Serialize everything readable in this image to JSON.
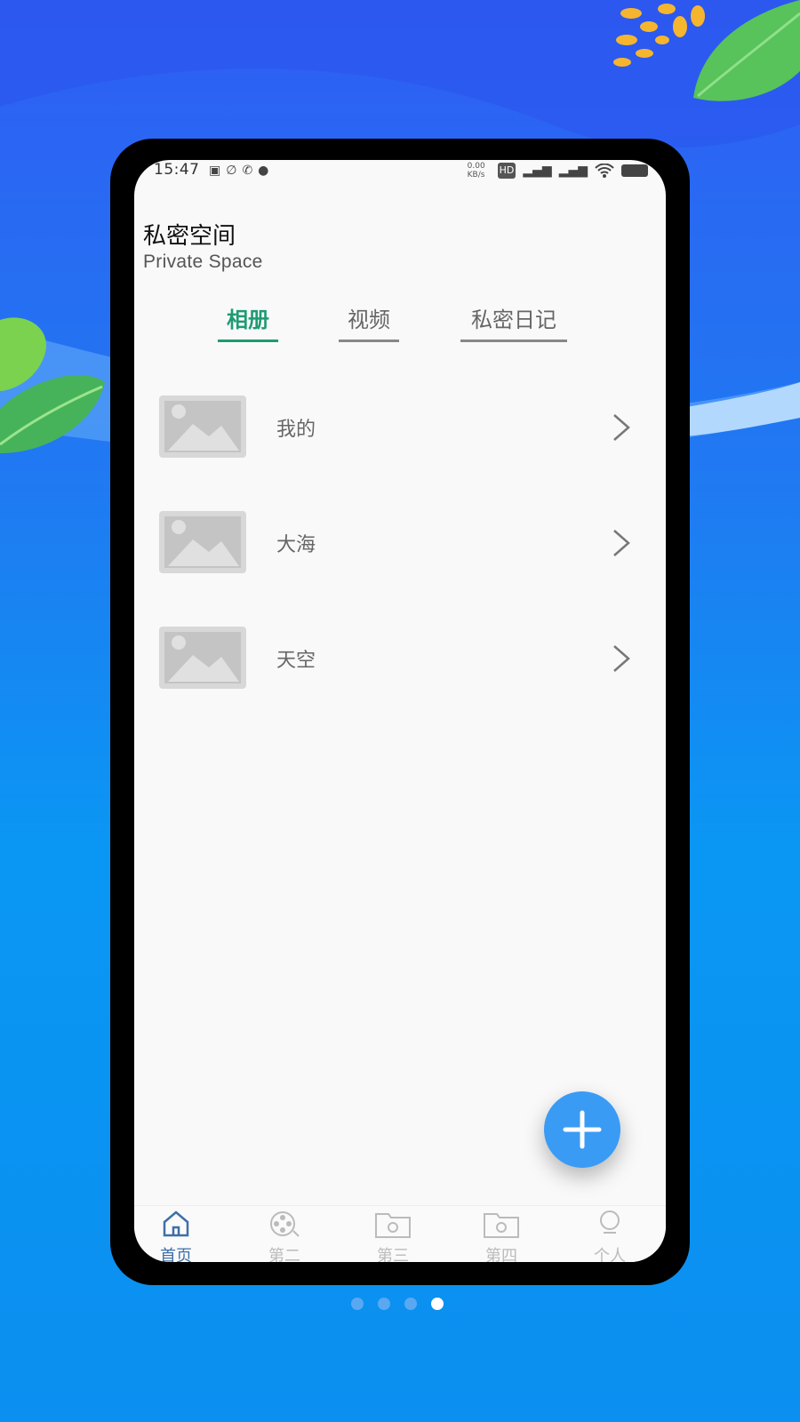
{
  "status_bar": {
    "time": "15:47",
    "network_speed": "0.00 KB/s",
    "icons_left": [
      "sim-icon",
      "link-icon",
      "phone-icon",
      "chat-icon"
    ],
    "icons_right": [
      "hd-icon",
      "signal-4g-icon",
      "signal-4g-icon",
      "wifi-icon",
      "battery-icon"
    ]
  },
  "header": {
    "title": "私密空间",
    "subtitle": "Private Space"
  },
  "tabs": [
    {
      "label": "相册",
      "active": true
    },
    {
      "label": "视频",
      "active": false
    },
    {
      "label": "私密日记",
      "active": false
    }
  ],
  "albums": [
    {
      "name": "我的",
      "icon": "image-placeholder-icon"
    },
    {
      "name": "大海",
      "icon": "image-placeholder-icon"
    },
    {
      "name": "天空",
      "icon": "image-placeholder-icon"
    }
  ],
  "fab": {
    "icon": "plus-icon"
  },
  "bottom_nav": [
    {
      "label": "首页",
      "icon": "home-icon",
      "active": true
    },
    {
      "label": "第二",
      "icon": "film-reel-icon",
      "active": false
    },
    {
      "label": "第三",
      "icon": "folder-gear-icon",
      "active": false
    },
    {
      "label": "第四",
      "icon": "folder-gear-icon",
      "active": false
    },
    {
      "label": "个人",
      "icon": "profile-icon",
      "active": false
    }
  ],
  "pager": {
    "count": 4,
    "active_index": 3
  },
  "colors": {
    "accent_green": "#1e9b73",
    "fab_blue": "#3a9bf5",
    "nav_active": "#3d6fa8",
    "background_blue": "#1f7bf2"
  }
}
